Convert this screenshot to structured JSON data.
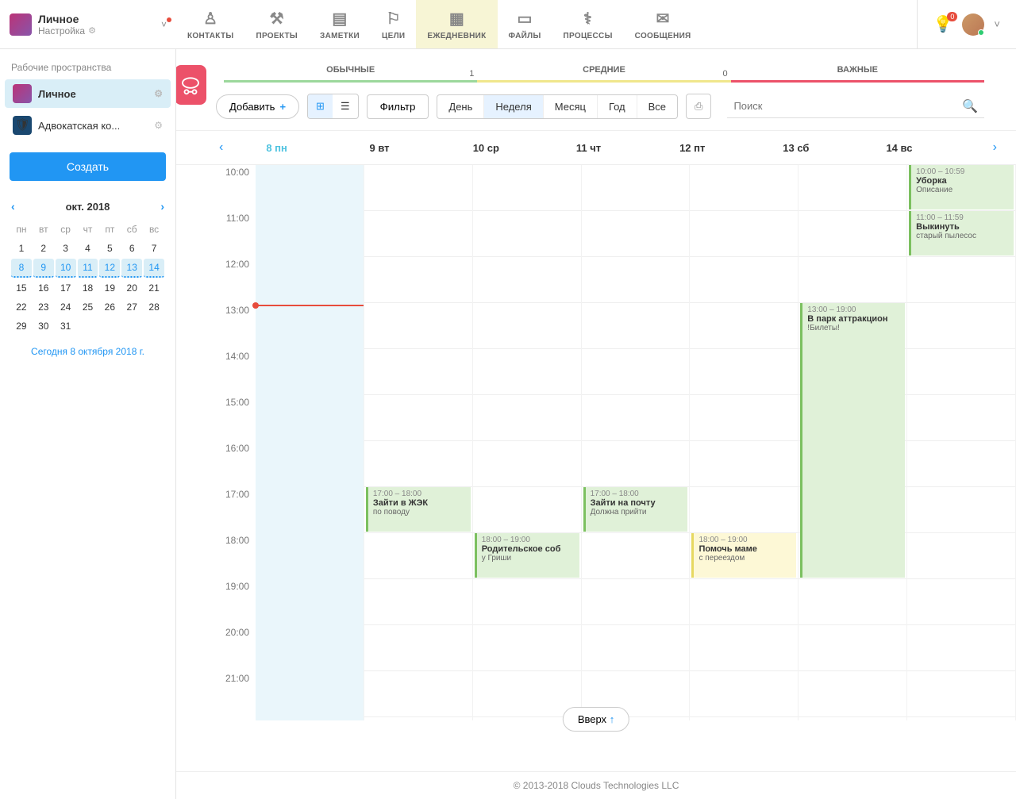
{
  "workspace": {
    "title": "Личное",
    "subtitle": "Настройка"
  },
  "nav": {
    "contacts": "КОНТАКТЫ",
    "projects": "ПРОЕКТЫ",
    "notes": "ЗАМЕТКИ",
    "goals": "ЦЕЛИ",
    "diary": "ЕЖЕДНЕВНИК",
    "files": "ФАЙЛЫ",
    "processes": "ПРОЦЕССЫ",
    "messages": "СООБЩЕНИЯ"
  },
  "notif_count": "0",
  "sidebar": {
    "label": "Рабочие пространства",
    "items": [
      {
        "name": "Личное"
      },
      {
        "name": "Адвокатская ко..."
      }
    ],
    "create": "Создать"
  },
  "minical": {
    "month": "окт. 2018",
    "dh": [
      "пн",
      "вт",
      "ср",
      "чт",
      "пт",
      "сб",
      "вс"
    ],
    "rows": [
      [
        "1",
        "2",
        "3",
        "4",
        "5",
        "6",
        "7"
      ],
      [
        "8",
        "9",
        "10",
        "11",
        "12",
        "13",
        "14"
      ],
      [
        "15",
        "16",
        "17",
        "18",
        "19",
        "20",
        "21"
      ],
      [
        "22",
        "23",
        "24",
        "25",
        "26",
        "27",
        "28"
      ],
      [
        "29",
        "30",
        "31",
        "",
        "",
        "",
        ""
      ]
    ],
    "today": "Сегодня 8 октября 2018 г."
  },
  "stats": {
    "normal": "ОБЫЧНЫЕ",
    "medium": "СРЕДНИЕ",
    "important": "ВАЖНЫЕ",
    "count_normal": "1",
    "count_medium": "0"
  },
  "toolbar": {
    "add": "Добавить",
    "filter": "Фильтр",
    "day": "День",
    "week": "Неделя",
    "month": "Месяц",
    "year": "Год",
    "all": "Все",
    "search_ph": "Поиск"
  },
  "week": {
    "days": [
      "8 пн",
      "9 вт",
      "10 ср",
      "11 чт",
      "12 пт",
      "13 сб",
      "14 вс"
    ]
  },
  "hours": [
    "10:00",
    "11:00",
    "12:00",
    "13:00",
    "14:00",
    "15:00",
    "16:00",
    "17:00",
    "18:00",
    "19:00",
    "20:00",
    "21:00"
  ],
  "events": {
    "e1": {
      "time": "17:00 – 18:00",
      "title": "Зайти в ЖЭК",
      "desc": "по поводу"
    },
    "e2": {
      "time": "18:00 – 19:00",
      "title": "Родительское соб",
      "desc": "у Гриши"
    },
    "e3": {
      "time": "17:00 – 18:00",
      "title": "Зайти на почту",
      "desc": "Должна прийти"
    },
    "e4": {
      "time": "18:00 – 19:00",
      "title": "Помочь маме",
      "desc": "с переездом"
    },
    "e5": {
      "time": "13:00 – 19:00",
      "title": "В парк аттракцион",
      "desc": "!Билеты!"
    },
    "e6": {
      "time": "10:00 – 10:59",
      "title": "Уборка",
      "desc": "Описание"
    },
    "e7": {
      "time": "11:00 – 11:59",
      "title": "Выкинуть",
      "desc": "старый пылесос"
    }
  },
  "up_btn": "Вверх",
  "footer": "© 2013-2018 Clouds Technologies LLC"
}
